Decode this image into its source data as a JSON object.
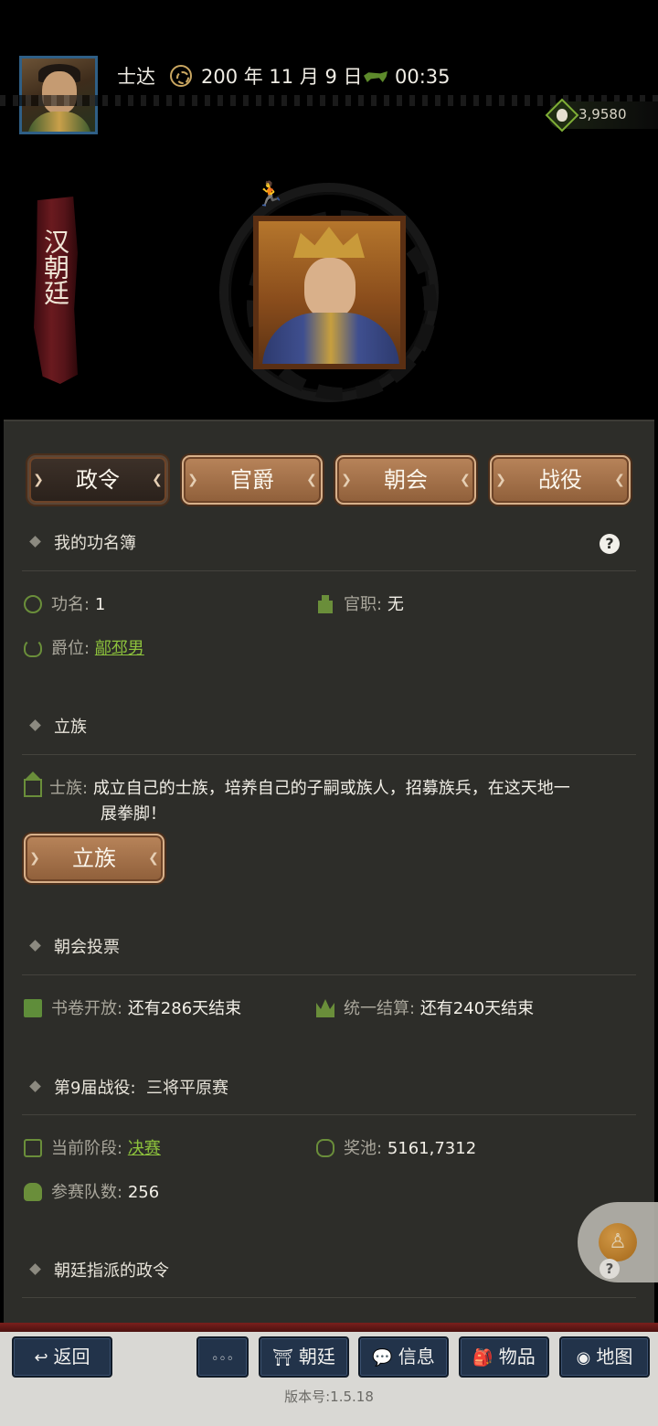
{
  "header": {
    "player_name": "士达",
    "date": "200 年 11 月 9 日",
    "time": "00:35",
    "currency": "3,9580"
  },
  "faction": {
    "name": "汉朝廷"
  },
  "tabs": [
    {
      "label": "政令",
      "active": true
    },
    {
      "label": "官爵",
      "active": false
    },
    {
      "label": "朝会",
      "active": false
    },
    {
      "label": "战役",
      "active": false
    }
  ],
  "merit": {
    "title": "我的功名簿",
    "merit_label": "功名:",
    "merit_value": "1",
    "office_label": "官职:",
    "office_value": "无",
    "rank_label": "爵位:",
    "rank_value": "鄗邳男"
  },
  "clan": {
    "title": "立族",
    "label": "士族:",
    "desc_line1": "成立自己的士族，培养自己的子嗣或族人，招募族兵，在这天地一",
    "desc_line2": "展拳脚！",
    "button_label": "立族"
  },
  "court_vote": {
    "title": "朝会投票",
    "scroll_label": "书卷开放:",
    "scroll_value": "还有286天结束",
    "settle_label": "统一结算:",
    "settle_value": "还有240天结束"
  },
  "campaign": {
    "title": "第9届战役:  三将平原赛",
    "stage_label": "当前阶段:",
    "stage_value": "决赛",
    "pool_label": "奖池:",
    "pool_value": "5161,7312",
    "teams_label": "参赛队数:",
    "teams_value": "256"
  },
  "decrees": {
    "title": "朝廷指派的政令"
  },
  "nav": {
    "back": "返回",
    "more": "◦◦◦",
    "court": "朝廷",
    "info": "信息",
    "items": "物品",
    "map": "地图"
  },
  "version": "版本号:1.5.18",
  "colors": {
    "panel_bg": "#2d2d29",
    "tab_bronze": "#a87450",
    "link_green": "#8dc23c",
    "nav_blue": "#22334a",
    "banner_red": "#6a1a1f"
  }
}
